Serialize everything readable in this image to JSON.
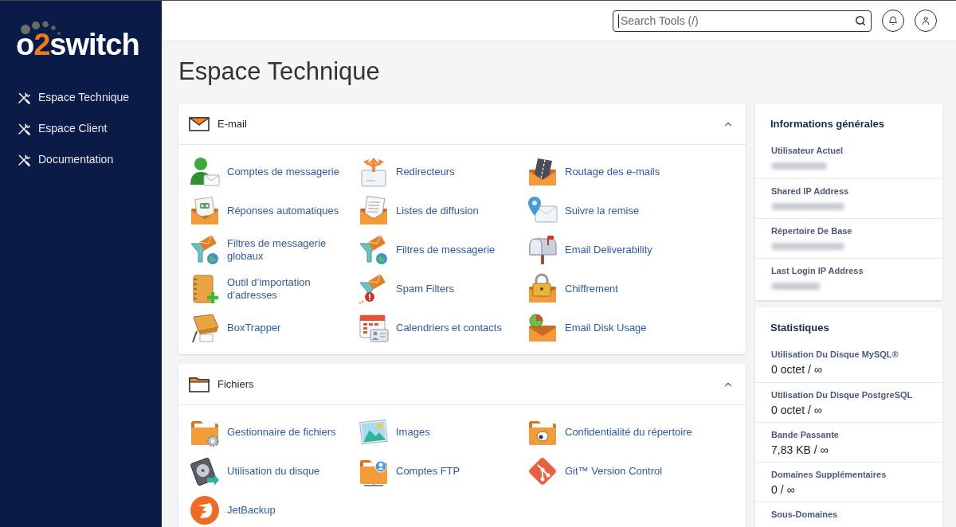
{
  "sidebar": {
    "logo": {
      "parts": [
        {
          "text": "o",
          "accent": false
        },
        {
          "text": "2",
          "accent": true
        },
        {
          "text": "switch",
          "accent": false
        }
      ]
    },
    "items": [
      {
        "label": "Espace Technique"
      },
      {
        "label": "Espace Client"
      },
      {
        "label": "Documentation"
      }
    ]
  },
  "topbar": {
    "search": {
      "placeholder": "Search Tools (/)",
      "focused": true
    }
  },
  "page_title": "Espace Technique",
  "sections": [
    {
      "title": "E-mail",
      "expanded": true,
      "items": [
        {
          "label": "Comptes de messagerie"
        },
        {
          "label": "Redirecteurs"
        },
        {
          "label": "Routage des e-mails"
        },
        {
          "label": "Réponses automatiques"
        },
        {
          "label": "Listes de diffusion"
        },
        {
          "label": "Suivre la remise"
        },
        {
          "label": "Filtres de messagerie globaux"
        },
        {
          "label": "Filtres de messagerie"
        },
        {
          "label": "Email Deliverability"
        },
        {
          "label": "Outil d’importation d’adresses"
        },
        {
          "label": "Spam Filters"
        },
        {
          "label": "Chiffrement"
        },
        {
          "label": "BoxTrapper"
        },
        {
          "label": "Calendriers et contacts"
        },
        {
          "label": "Email Disk Usage"
        }
      ]
    },
    {
      "title": "Fichiers",
      "expanded": true,
      "items": [
        {
          "label": "Gestionnaire de fichiers"
        },
        {
          "label": "Images"
        },
        {
          "label": "Confidentialité du répertoire"
        },
        {
          "label": "Utilisation du disque"
        },
        {
          "label": "Comptes FTP"
        },
        {
          "label": "Git™ Version Control"
        },
        {
          "label": "JetBackup"
        }
      ]
    }
  ],
  "info_cards": [
    {
      "title": "Informations générales",
      "rows": [
        {
          "label": "Utilisateur Actuel",
          "blurred": true
        },
        {
          "label": "Shared IP Address",
          "blurred": true
        },
        {
          "label": "Répertoire De Base",
          "blurred": true
        },
        {
          "label": "Last Login IP Address",
          "blurred": true
        }
      ]
    },
    {
      "title": "Statistiques",
      "rows": [
        {
          "label": "Utilisation Du Disque MySQL®",
          "blurred": false,
          "value": "0 octet / ∞"
        },
        {
          "label": "Utilisation Du Disque PostgreSQL",
          "blurred": false,
          "value": "0 octet / ∞"
        },
        {
          "label": "Bande Passante",
          "blurred": false,
          "value": "7,83 KB / ∞"
        },
        {
          "label": "Domaines Supplémentaires",
          "blurred": false,
          "value": "0 / ∞"
        },
        {
          "label": "Sous-Domaines",
          "blurred": false
        }
      ]
    }
  ]
}
